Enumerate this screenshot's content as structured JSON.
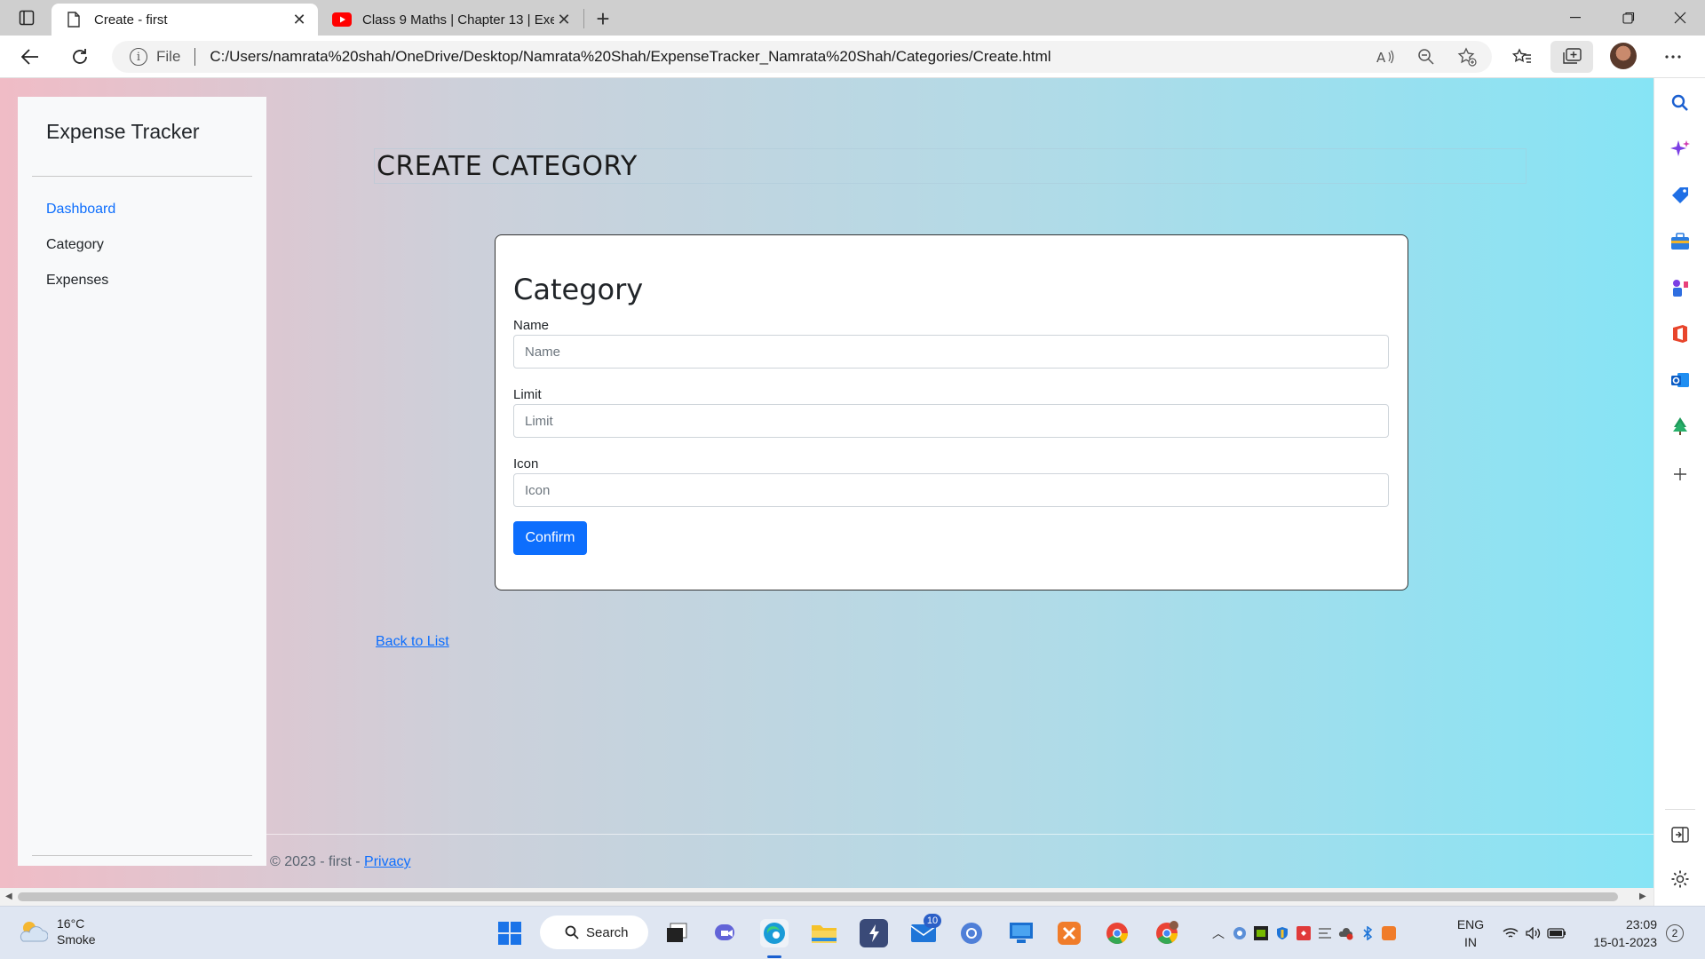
{
  "browser": {
    "tabs": [
      {
        "title": "Create - first",
        "active": true,
        "icon": "document-icon"
      },
      {
        "title": "Class 9 Maths | Chapter 13 | Exer",
        "active": false,
        "icon": "youtube-icon"
      }
    ],
    "address": {
      "scheme_label": "File",
      "url": "C:/Users/namrata%20shah/OneDrive/Desktop/Namrata%20Shah/ExpenseTracker_Namrata%20Shah/Categories/Create.html"
    }
  },
  "sidebar": {
    "brand": "Expense Tracker",
    "items": [
      {
        "label": "Dashboard",
        "active": true
      },
      {
        "label": "Category",
        "active": false
      },
      {
        "label": "Expenses",
        "active": false
      }
    ]
  },
  "page": {
    "heading": "CREATE CATEGORY",
    "card_title": "Category",
    "fields": [
      {
        "label": "Name",
        "placeholder": "Name",
        "value": ""
      },
      {
        "label": "Limit",
        "placeholder": "Limit",
        "value": ""
      },
      {
        "label": "Icon",
        "placeholder": "Icon",
        "value": ""
      }
    ],
    "confirm_label": "Confirm",
    "back_link": "Back to List",
    "footer_text": "© 2023 - first - ",
    "footer_link": "Privacy"
  },
  "taskbar": {
    "weather_temp": "16°C",
    "weather_desc": "Smoke",
    "search_label": "Search",
    "mail_badge": "10",
    "lang_line1": "ENG",
    "lang_line2": "IN",
    "time": "23:09",
    "date": "15-01-2023",
    "notifications": "2"
  },
  "colors": {
    "accent": "#0d6efd",
    "gradient_left": "#f0bcc6",
    "gradient_right": "#86e4f5"
  }
}
